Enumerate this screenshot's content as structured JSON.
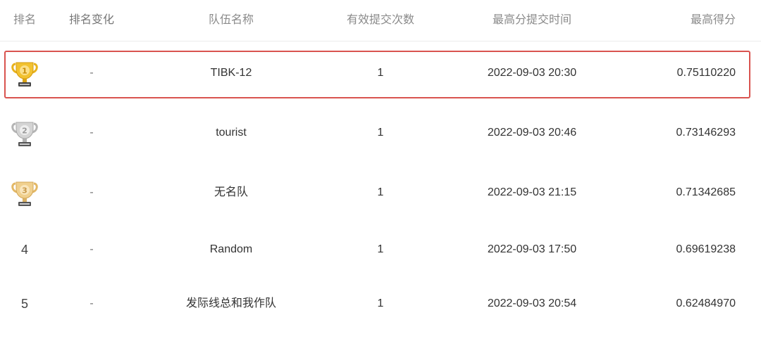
{
  "headers": {
    "rank": "排名",
    "rank_change": "排名变化",
    "team_name": "队伍名称",
    "valid_submissions": "有效提交次数",
    "best_submit_time": "最高分提交时间",
    "best_score": "最高得分"
  },
  "rows": [
    {
      "rank": "1",
      "rank_change": "-",
      "team": "TIBK-12",
      "submissions": "1",
      "time": "2022-09-03 20:30",
      "score": "0.75110220",
      "trophy": "gold-trophy-icon",
      "highlighted": true
    },
    {
      "rank": "2",
      "rank_change": "-",
      "team": "tourist",
      "submissions": "1",
      "time": "2022-09-03 20:46",
      "score": "0.73146293",
      "trophy": "silver-trophy-icon",
      "highlighted": false
    },
    {
      "rank": "3",
      "rank_change": "-",
      "team": "无名队",
      "submissions": "1",
      "time": "2022-09-03 21:15",
      "score": "0.71342685",
      "trophy": "bronze-trophy-icon",
      "highlighted": false
    },
    {
      "rank": "4",
      "rank_change": "-",
      "team": "Random",
      "submissions": "1",
      "time": "2022-09-03 17:50",
      "score": "0.69619238",
      "trophy": "",
      "highlighted": false
    },
    {
      "rank": "5",
      "rank_change": "-",
      "team": "发际线总和我作队",
      "submissions": "1",
      "time": "2022-09-03 20:54",
      "score": "0.62484970",
      "trophy": "",
      "highlighted": false
    }
  ],
  "colors": {
    "highlight_border": "#d9534f",
    "gold": "#e8b21c",
    "silver": "#c7c7c7",
    "bronze": "#e6c27a",
    "header_text": "#8a8a8a"
  }
}
